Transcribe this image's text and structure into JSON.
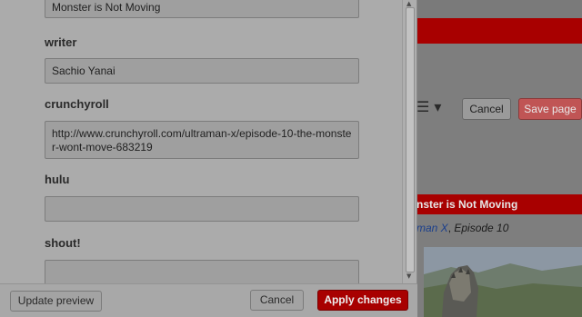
{
  "background_page": {
    "toolbar": {
      "menu_icon": "hamburger-dropdown-icon",
      "cancel_label": "Cancel",
      "save_label": "Save page"
    },
    "preview": {
      "title": "nster is Not Moving",
      "subtitle_link": "man X",
      "subtitle_rest": "Episode 10"
    }
  },
  "dialog": {
    "fields": [
      {
        "label": "",
        "value": "Monster is Not Moving"
      },
      {
        "label": "writer",
        "value": "Sachio Yanai"
      },
      {
        "label": "crunchyroll",
        "value": "http://www.crunchyroll.com/ultraman-x/episode-10-the-monster-wont-move-683219"
      },
      {
        "label": "hulu",
        "value": ""
      },
      {
        "label": "shout!",
        "value": ""
      }
    ],
    "buttons": {
      "update_preview": "Update preview",
      "cancel": "Cancel",
      "apply": "Apply changes"
    }
  },
  "colors": {
    "accent_red": "#a80000",
    "dim_gray": "#ababab"
  }
}
